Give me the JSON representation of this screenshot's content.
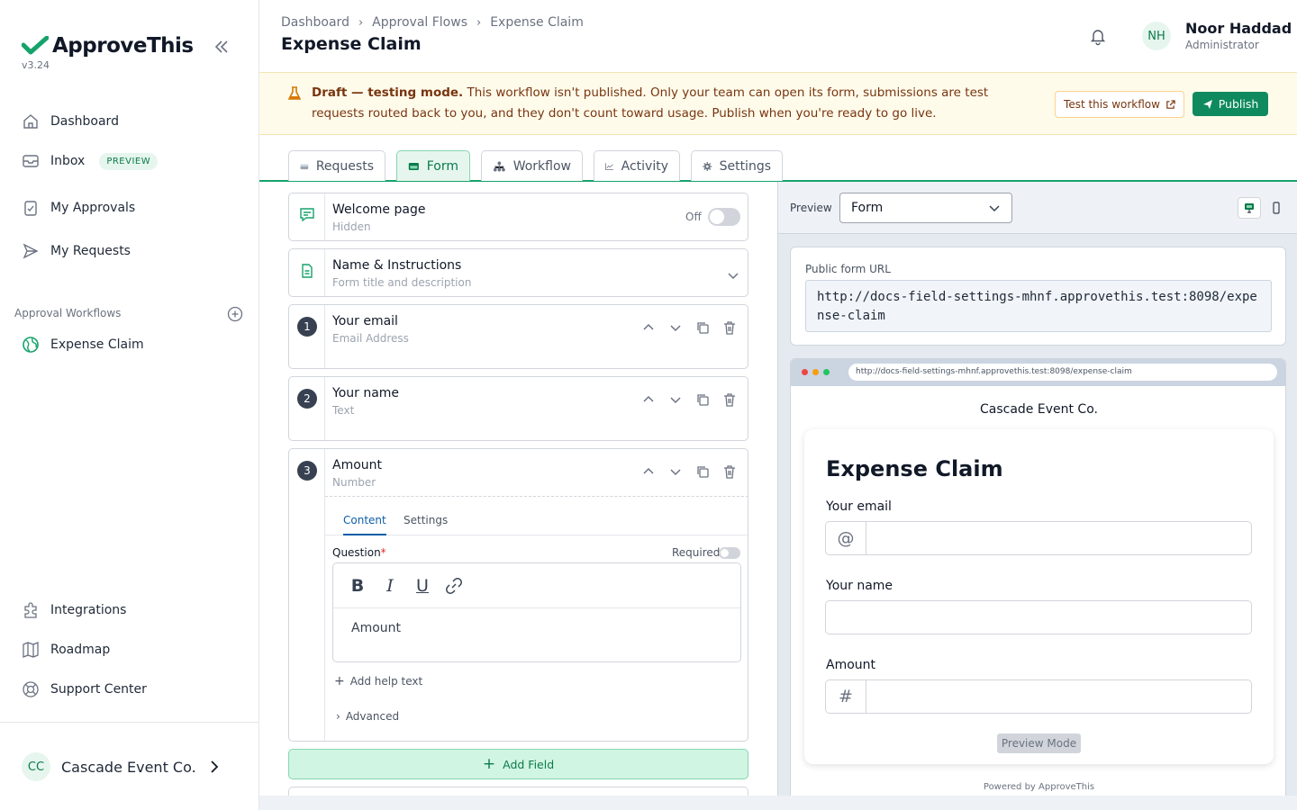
{
  "app": {
    "name": "ApproveThis",
    "version": "v3.24",
    "accent": "#16a36b"
  },
  "sidebar": {
    "nav": [
      {
        "label": "Dashboard",
        "icon": "home-icon"
      },
      {
        "label": "Inbox",
        "icon": "inbox-icon",
        "badge": "PREVIEW"
      },
      {
        "label": "My Approvals",
        "icon": "clipboard-check-icon"
      },
      {
        "label": "My Requests",
        "icon": "send-icon"
      }
    ],
    "section_label": "Approval Workflows",
    "workflows": [
      {
        "label": "Expense Claim",
        "icon": "globe-icon"
      }
    ],
    "footer_nav": [
      {
        "label": "Integrations",
        "icon": "puzzle-icon"
      },
      {
        "label": "Roadmap",
        "icon": "map-icon"
      },
      {
        "label": "Support Center",
        "icon": "lifebuoy-icon"
      }
    ],
    "org": {
      "initials": "CC",
      "name": "Cascade Event Co."
    }
  },
  "header": {
    "breadcrumbs": [
      "Dashboard",
      "Approval Flows",
      "Expense Claim"
    ],
    "title": "Expense Claim",
    "user": {
      "initials": "NH",
      "name": "Noor Haddad",
      "role": "Administrator"
    }
  },
  "draft_banner": {
    "strong": "Draft — testing mode.",
    "text": " This workflow isn't published. Only your team can open its form, submissions are test requests routed back to you, and they don't count toward usage. Publish when you're ready to go live.",
    "test_button": "Test this workflow",
    "publish_button": "Publish"
  },
  "tabs": [
    {
      "label": "Requests",
      "icon": "inbox-tray-icon"
    },
    {
      "label": "Form",
      "icon": "form-icon",
      "active": true
    },
    {
      "label": "Workflow",
      "icon": "workflow-icon"
    },
    {
      "label": "Activity",
      "icon": "chart-line-icon"
    },
    {
      "label": "Settings",
      "icon": "gear-icon"
    }
  ],
  "builder": {
    "welcome": {
      "title": "Welcome page",
      "subtitle": "Hidden",
      "toggle_label": "Off"
    },
    "instructions": {
      "title": "Name & Instructions",
      "subtitle": "Form title and description"
    },
    "fields": [
      {
        "number": "1",
        "title": "Your email",
        "type": "Email Address"
      },
      {
        "number": "2",
        "title": "Your name",
        "type": "Text"
      },
      {
        "number": "3",
        "title": "Amount",
        "type": "Number"
      }
    ],
    "expanded": {
      "subtabs": [
        "Content",
        "Settings"
      ],
      "question_label": "Question",
      "required_mark": "*",
      "required_label": "Required",
      "question_value": "Amount",
      "add_help": "Add help text",
      "advanced": "Advanced"
    },
    "add_field": "Add Field"
  },
  "preview": {
    "label": "Preview",
    "select_value": "Form",
    "public_url_label": "Public form URL",
    "public_url": "http://docs-field-settings-mhnf.approvethis.test:8098/expense-claim",
    "browser_url": "http://docs-field-settings-mhnf.approvethis.test:8098/expense-claim",
    "company": "Cascade Event Co.",
    "form_title": "Expense Claim",
    "fields": [
      {
        "label": "Your email",
        "addon": "@"
      },
      {
        "label": "Your name",
        "addon": ""
      },
      {
        "label": "Amount",
        "addon": "#"
      }
    ],
    "preview_mode": "Preview Mode",
    "powered": "Powered by ApproveThis"
  }
}
